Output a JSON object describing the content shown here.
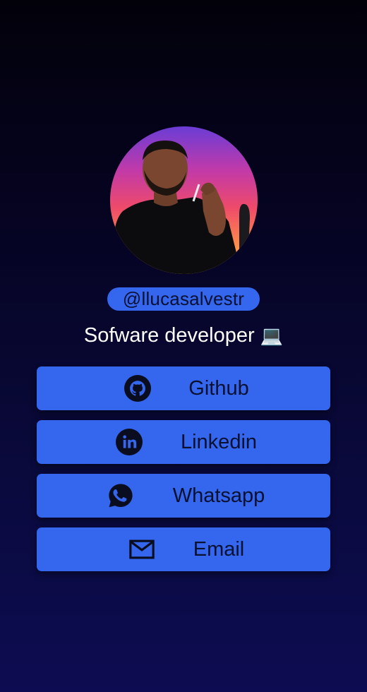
{
  "profile": {
    "handle": "@llucasalvestr",
    "role": "Sofware developer",
    "role_emoji": "💻",
    "avatar_icon": "profile-photo"
  },
  "links": [
    {
      "label": "Github",
      "icon": "github-icon"
    },
    {
      "label": "Linkedin",
      "icon": "linkedin-icon"
    },
    {
      "label": "Whatsapp",
      "icon": "whatsapp-icon"
    },
    {
      "label": "Email",
      "icon": "email-icon"
    }
  ],
  "colors": {
    "accent": "#3467ee",
    "button_text": "#0a1030",
    "background_top": "#02010a",
    "background_bottom": "#0d0c52"
  }
}
